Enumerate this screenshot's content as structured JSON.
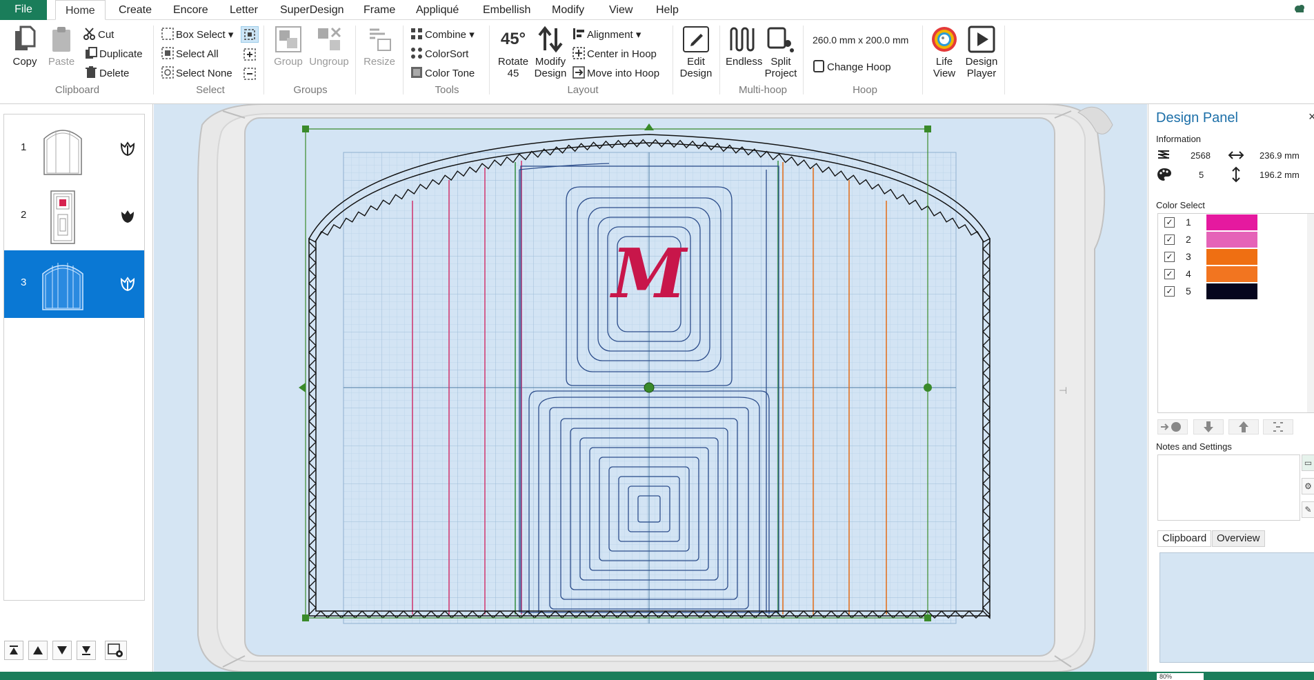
{
  "menu": {
    "file": "File",
    "tabs": [
      "Home",
      "Create",
      "Encore",
      "Letter",
      "SuperDesign",
      "Frame",
      "Appliqué",
      "Embellish",
      "Modify",
      "View",
      "Help"
    ]
  },
  "ribbon": {
    "clipboard": {
      "copy": "Copy",
      "paste": "Paste",
      "cut": "Cut",
      "duplicate": "Duplicate",
      "delete": "Delete",
      "label": "Clipboard"
    },
    "select": {
      "box_select": "Box Select",
      "select_all": "Select All",
      "select_none": "Select None",
      "label": "Select"
    },
    "groups": {
      "group": "Group",
      "ungroup": "Ungroup",
      "label": "Groups"
    },
    "resize": {
      "resize": "Resize"
    },
    "tools": {
      "combine": "Combine",
      "colorsort": "ColorSort",
      "color_tone": "Color Tone",
      "label": "Tools"
    },
    "layout": {
      "rotate_line1": "Rotate",
      "rotate_line2": "45",
      "modify_line1": "Modify",
      "modify_line2": "Design",
      "alignment": "Alignment",
      "center_in_hoop": "Center in Hoop",
      "move_into_hoop": "Move into Hoop",
      "label": "Layout",
      "rotate_icon_text": "45°"
    },
    "edit": {
      "line1": "Edit",
      "line2": "Design"
    },
    "multihoop": {
      "endless": "Endless",
      "split_line1": "Split",
      "split_line2": "Project",
      "label": "Multi-hoop"
    },
    "hoop": {
      "size": "260.0 mm x 200.0 mm",
      "change_hoop": "Change Hoop",
      "label": "Hoop"
    },
    "view": {
      "life_line1": "Life",
      "life_line2": "View",
      "player_line1": "Design",
      "player_line2": "Player"
    }
  },
  "layers": [
    {
      "num": "1",
      "selected": false
    },
    {
      "num": "2",
      "selected": false
    },
    {
      "num": "3",
      "selected": true
    }
  ],
  "canvas": {
    "monogram": "M"
  },
  "design_panel": {
    "title": "Design Panel",
    "close": "×",
    "information_label": "Information",
    "stitches": "2568",
    "width": "236.9 mm",
    "colors": "5",
    "height": "196.2 mm",
    "color_select_label": "Color Select",
    "color_list": [
      {
        "num": "1",
        "color": "#e5199f",
        "checked": "✓"
      },
      {
        "num": "2",
        "color": "#e563b8",
        "checked": "✓"
      },
      {
        "num": "3",
        "color": "#ef6f12",
        "checked": "✓"
      },
      {
        "num": "4",
        "color": "#f27520",
        "checked": "✓"
      },
      {
        "num": "5",
        "color": "#06061e",
        "checked": "✓"
      }
    ],
    "notes_label": "Notes and Settings",
    "tab_clipboard": "Clipboard",
    "tab_overview": "Overview"
  },
  "status": {
    "zoom": "80%"
  }
}
